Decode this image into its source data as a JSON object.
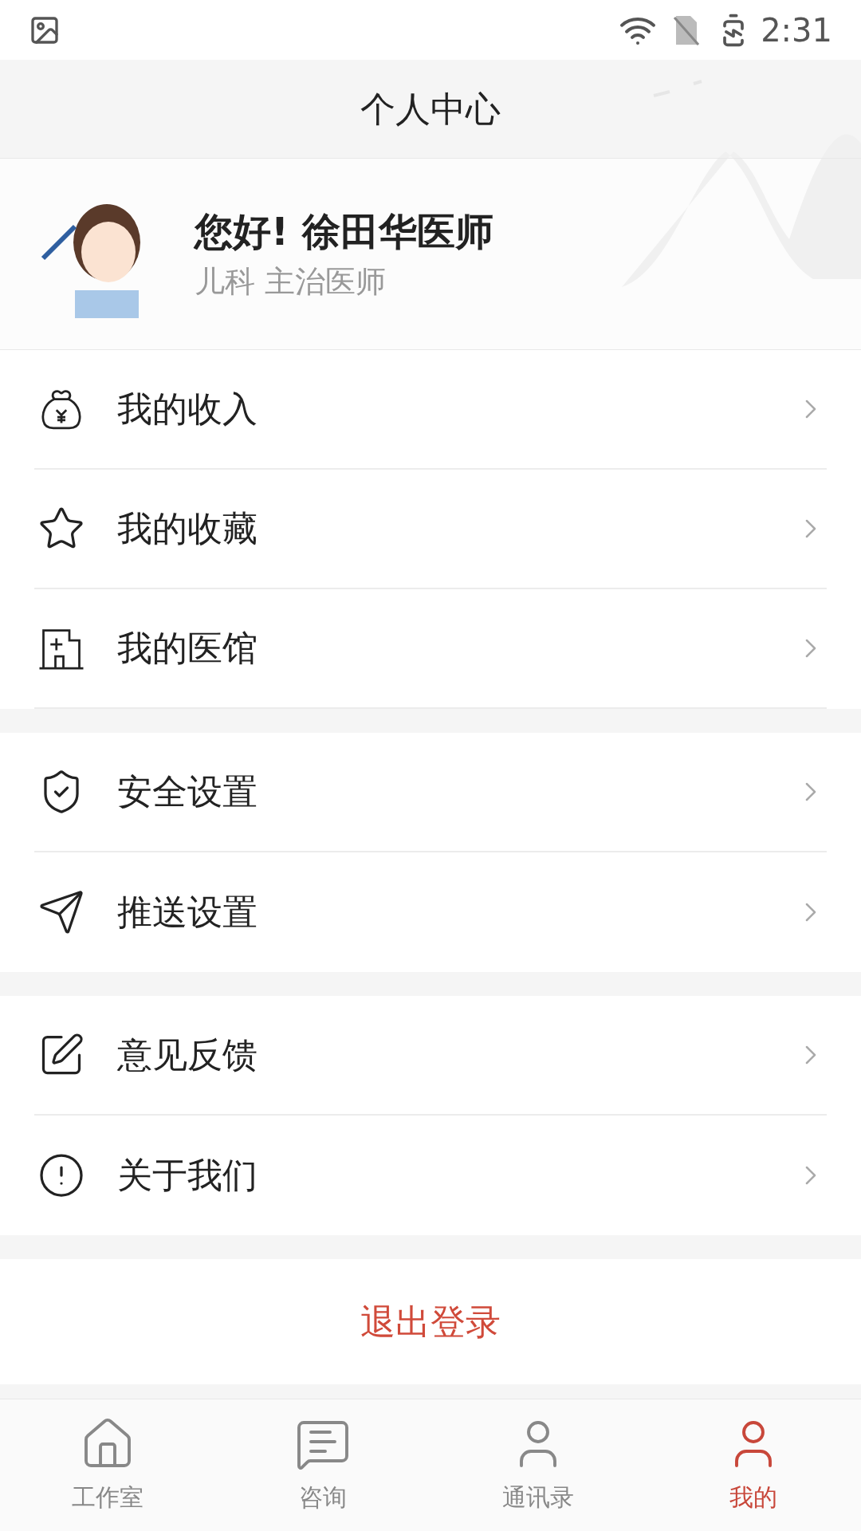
{
  "status_bar": {
    "time": "2:31"
  },
  "header": {
    "title": "个人中心"
  },
  "profile": {
    "greeting": "您好! 徐田华医师",
    "subtitle": "儿科 主治医师"
  },
  "menu_groups": [
    {
      "items": [
        {
          "kind": "income",
          "label": "我的收入"
        },
        {
          "kind": "favorites",
          "label": "我的收藏"
        },
        {
          "kind": "clinic",
          "label": "我的医馆"
        }
      ]
    },
    {
      "items": [
        {
          "kind": "security",
          "label": "安全设置"
        },
        {
          "kind": "push",
          "label": "推送设置"
        }
      ]
    },
    {
      "items": [
        {
          "kind": "feedback",
          "label": "意见反馈"
        },
        {
          "kind": "about",
          "label": "关于我们"
        }
      ]
    }
  ],
  "logout_button": "退出登录",
  "tab_bar": [
    {
      "kind": "home",
      "label": "工作室",
      "selected": false
    },
    {
      "kind": "chat",
      "label": "咨询",
      "selected": false
    },
    {
      "kind": "contacts",
      "label": "通讯录",
      "selected": false
    },
    {
      "kind": "me",
      "label": "我的",
      "selected": true
    }
  ]
}
